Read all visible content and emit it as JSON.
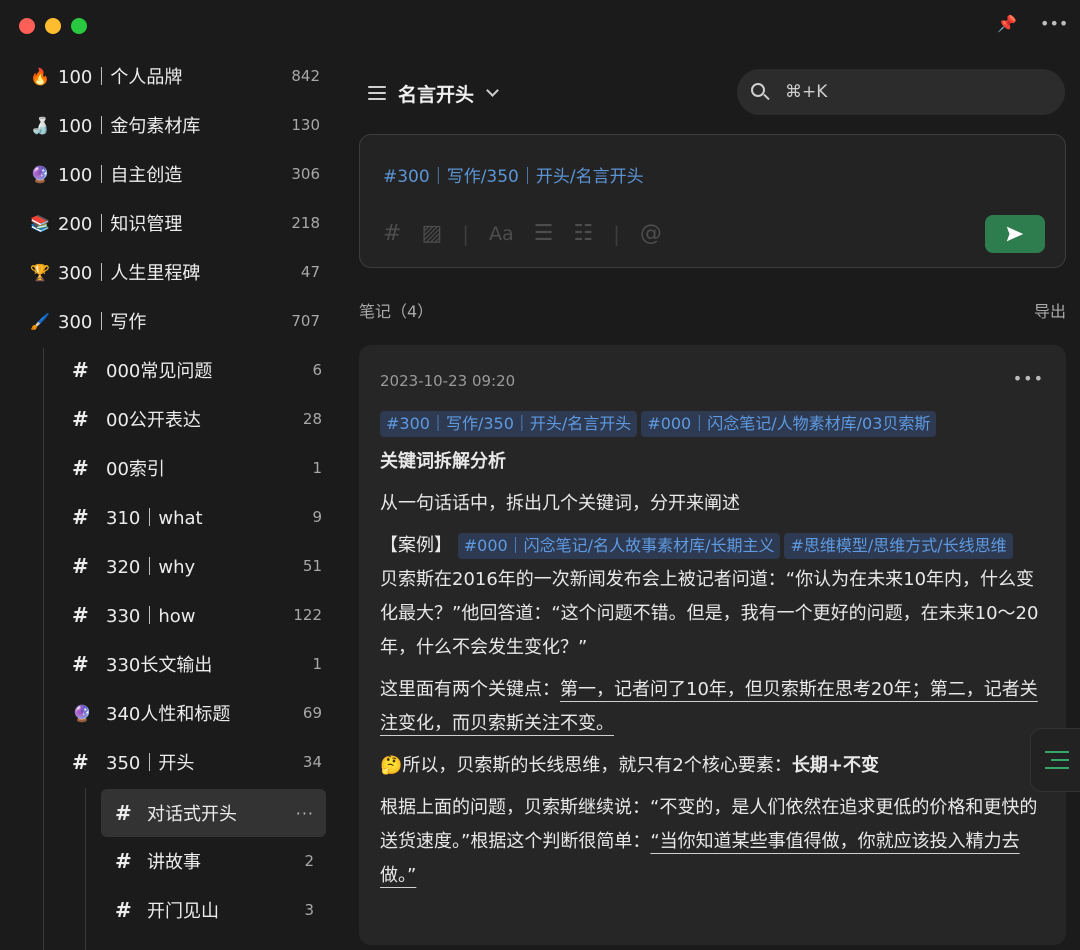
{
  "colors": {
    "accent_green": "#2e7d4f",
    "tag_blue": "#5f9ae0",
    "tag_bg": "#2d3a52"
  },
  "window": {
    "top_right_icons": [
      "pin-icon",
      "more-icon"
    ]
  },
  "sidebar": {
    "items": [
      {
        "emoji": "🔥",
        "label": "100｜个人品牌",
        "count": "842"
      },
      {
        "emoji": "🍶",
        "label": "100｜金句素材库",
        "count": "130"
      },
      {
        "emoji": "🔮",
        "label": "100｜自主创造",
        "count": "306"
      },
      {
        "emoji": "📚",
        "label": "200｜知识管理",
        "count": "218"
      },
      {
        "emoji": "🏆",
        "label": "300｜人生里程碑",
        "count": "47"
      },
      {
        "emoji": "🖌️",
        "label": "300｜写作",
        "count": "707"
      }
    ],
    "children": [
      {
        "icon": "#",
        "label": "000常见问题",
        "count": "6"
      },
      {
        "icon": "#",
        "label": "00公开表达",
        "count": "28"
      },
      {
        "icon": "#",
        "label": "00索引",
        "count": "1"
      },
      {
        "icon": "#",
        "label": "310｜what",
        "count": "9"
      },
      {
        "icon": "#",
        "label": "320｜why",
        "count": "51"
      },
      {
        "icon": "#",
        "label": "330｜how",
        "count": "122"
      },
      {
        "icon": "#",
        "label": "330长文输出",
        "count": "1"
      },
      {
        "icon": "🔮",
        "label": "340人性和标题",
        "count": "69"
      },
      {
        "icon": "#",
        "label": "350｜开头",
        "count": "34"
      }
    ],
    "grandchildren": [
      {
        "label": "对话式开头",
        "count": "···"
      },
      {
        "label": "讲故事",
        "count": "2"
      },
      {
        "label": "开门见山",
        "count": "3"
      }
    ]
  },
  "header": {
    "title": "名言开头"
  },
  "search": {
    "shortcut": "⌘+K"
  },
  "editor": {
    "tag_text": "#300｜写作/350｜开头/名言开头"
  },
  "notes": {
    "label": "笔记（4）",
    "export": "导出"
  },
  "card": {
    "date": "2023-10-23 09:20",
    "tags": [
      "#300｜写作/350｜开头/名言开头",
      "#000｜闪念笔记/人物素材库/03贝索斯"
    ],
    "heading": "关键词拆解分析",
    "p1": "从一句话话中，拆出几个关键词，分开来阐述",
    "case_label": "【案例】",
    "case_tags": [
      "#000｜闪念笔记/名人故事素材库/长期主义",
      "#思维模型/思维方式/长线思维"
    ],
    "p2": "贝索斯在2016年的一次新闻发布会上被记者问道：“你认为在未来10年内，什么变化最大？”他回答道：“这个问题不错。但是，我有一个更好的问题，在未来10～20年，什么不会发生变化？”",
    "p3_prefix": "这里面有两个关键点：",
    "p3_underlined": "第一，记者问了10年，但贝索斯在思考20年；第二，记者关注变化，而贝索斯关注不变。",
    "p4_prefix": "🤔所以，贝索斯的长线思维，就只有2个核心要素：",
    "p4_bold": "长期+不变",
    "p5_prefix": "根据上面的问题，贝索斯继续说：“不变的，是人们依然在追求更低的价格和更快的送货速度。”根据这个判断很简单：",
    "p5_underlined": "“当你知道某些事值得做，你就应该投入精力去做。”"
  }
}
